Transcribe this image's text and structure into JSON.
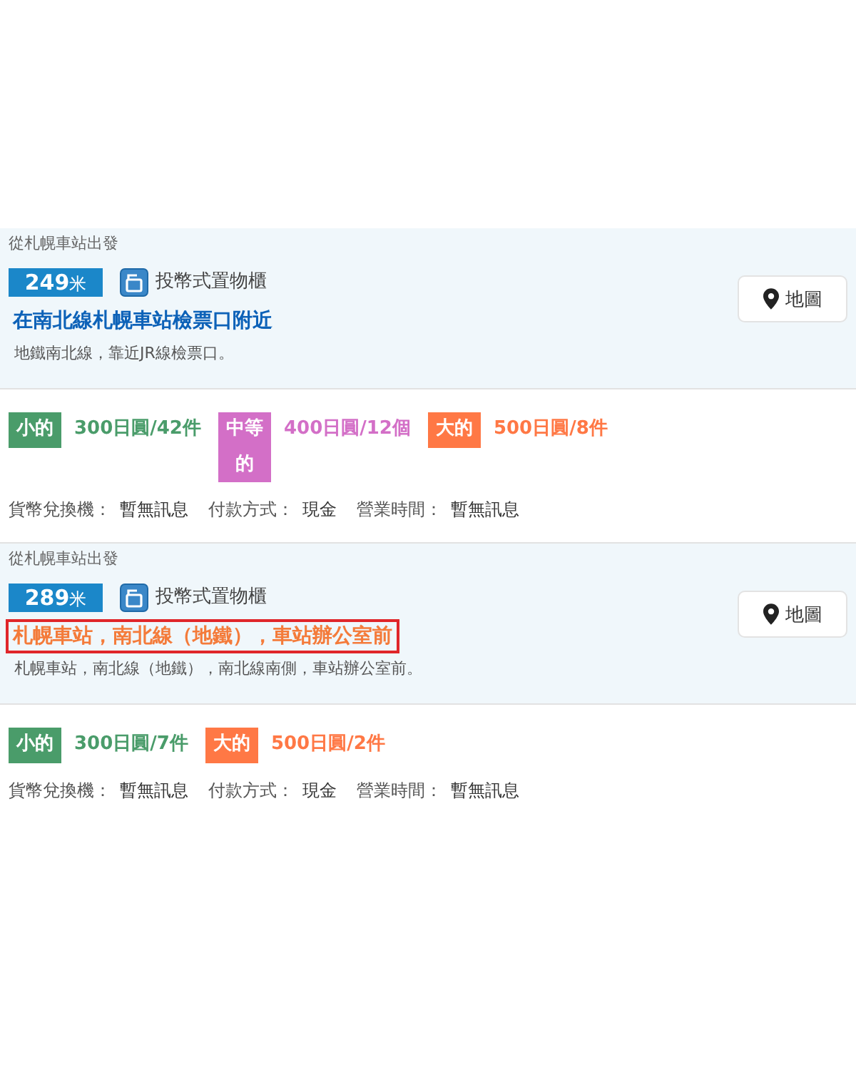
{
  "stations": [
    {
      "origin": "從札幌車站出發",
      "distance": {
        "value": "249",
        "unit": "米"
      },
      "locker_type": "投幣式置物櫃",
      "title": {
        "text": "在南北線札幌車站檢票口附近",
        "highlighted": false
      },
      "description": "地鐵南北線，靠近JR線檢票口。",
      "map_button": "地圖",
      "sizes": [
        {
          "label": "小的",
          "price": "300日圓/42件",
          "color": "#4a9c6a"
        },
        {
          "label": "中等的",
          "price": "400日圓/12個",
          "color": "#d36fc7"
        },
        {
          "label": "大的",
          "price": "500日圓/8件",
          "color": "#ff7845"
        }
      ],
      "info": [
        {
          "label": "貨幣兌換機：",
          "value": "暫無訊息"
        },
        {
          "label": "付款方式：",
          "value": "現金"
        },
        {
          "label": "營業時間：",
          "value": "暫無訊息"
        }
      ]
    },
    {
      "origin": "從札幌車站出發",
      "distance": {
        "value": "289",
        "unit": "米"
      },
      "locker_type": "投幣式置物櫃",
      "title": {
        "text": "札幌車站，南北線（地鐵），車站辦公室前",
        "highlighted": true
      },
      "description": "札幌車站，南北線（地鐵），南北線南側，車站辦公室前。",
      "map_button": "地圖",
      "sizes": [
        {
          "label": "小的",
          "price": "300日圓/7件",
          "color": "#4a9c6a"
        },
        {
          "label": "大的",
          "price": "500日圓/2件",
          "color": "#ff7845"
        }
      ],
      "info": [
        {
          "label": "貨幣兌換機：",
          "value": "暫無訊息"
        },
        {
          "label": "付款方式：",
          "value": "現金"
        },
        {
          "label": "營業時間：",
          "value": "暫無訊息"
        }
      ]
    }
  ]
}
